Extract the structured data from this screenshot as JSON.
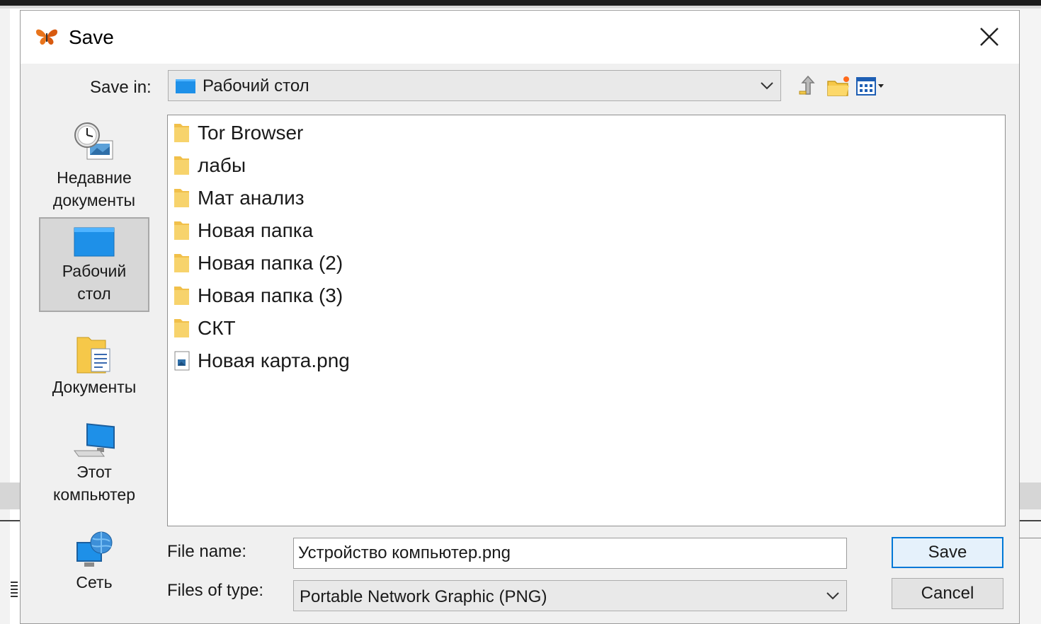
{
  "dialog": {
    "title": "Save",
    "close_icon": "close-icon",
    "accent_color": "#0078d7"
  },
  "save_in": {
    "label": "Save in:",
    "value": "Рабочий стол"
  },
  "toolbar": {
    "up_icon": "up-one-level-icon",
    "new_folder_icon": "new-folder-icon",
    "view_icon": "view-menu-icon"
  },
  "places": [
    {
      "label_line1": "Недавние",
      "label_line2": "документы",
      "icon": "recent-documents-icon"
    },
    {
      "label_line1": "Рабочий",
      "label_line2": "стол",
      "icon": "desktop-icon",
      "selected": true
    },
    {
      "label_line1": "Документы",
      "label_line2": "",
      "icon": "documents-folder-icon"
    },
    {
      "label_line1": "Этот",
      "label_line2": "компьютер",
      "icon": "computer-icon"
    },
    {
      "label_line1": "Сеть",
      "label_line2": "",
      "icon": "network-icon"
    }
  ],
  "files": [
    {
      "name": "Tor Browser",
      "type": "folder"
    },
    {
      "name": "лабы",
      "type": "folder"
    },
    {
      "name": "Мат анализ",
      "type": "folder"
    },
    {
      "name": "Новая папка",
      "type": "folder"
    },
    {
      "name": "Новая папка (2)",
      "type": "folder"
    },
    {
      "name": "Новая папка (3)",
      "type": "folder"
    },
    {
      "name": "СКТ",
      "type": "folder"
    },
    {
      "name": "Новая карта.png",
      "type": "image"
    }
  ],
  "file_name": {
    "label": "File name:",
    "value": "Устройство компьютер.png"
  },
  "file_type": {
    "label": "Files of type:",
    "value": "Portable Network Graphic (PNG)"
  },
  "buttons": {
    "save": "Save",
    "cancel": "Cancel"
  }
}
